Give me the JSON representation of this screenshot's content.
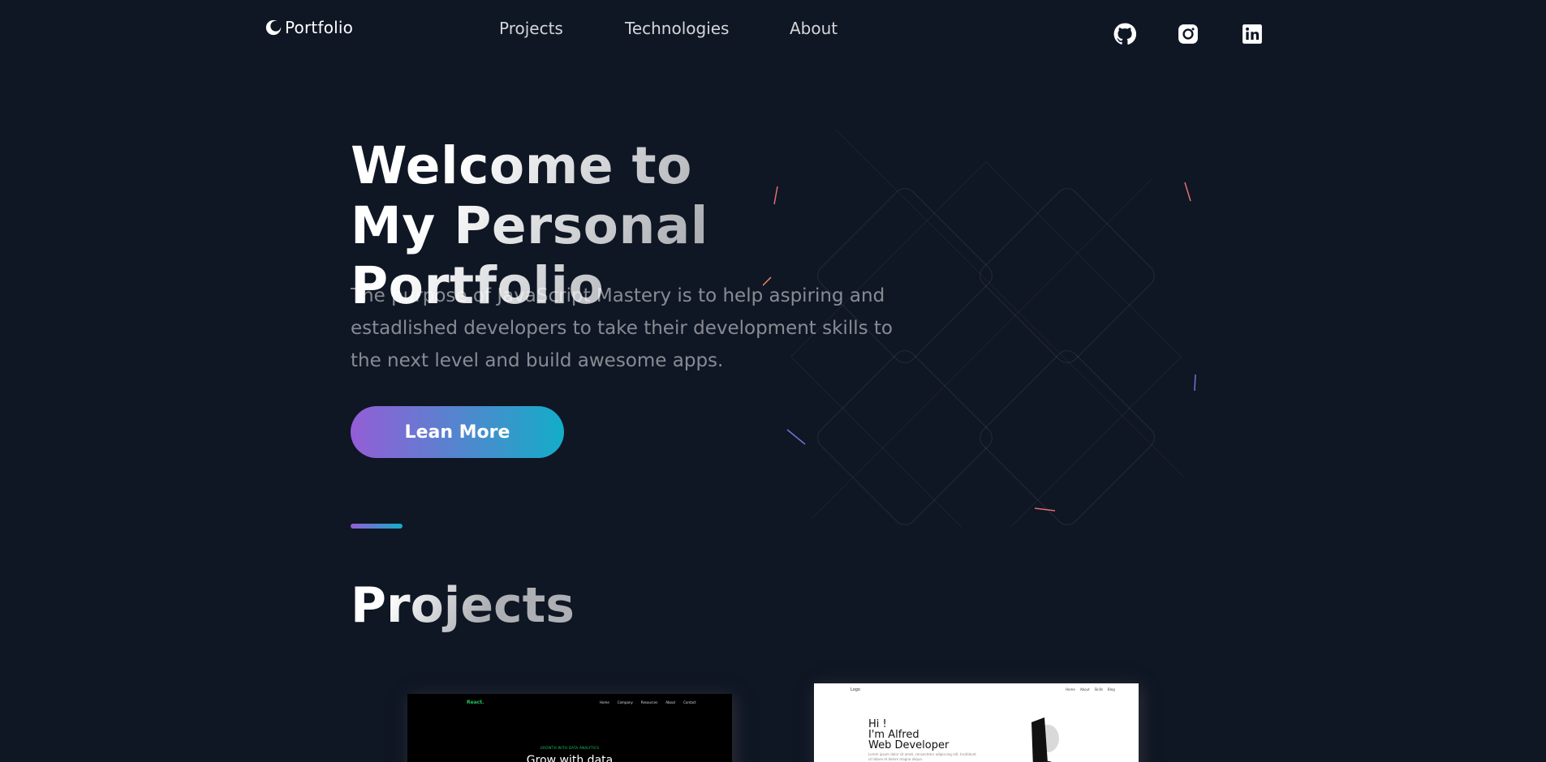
{
  "header": {
    "logo_text": "Portfolio",
    "nav": [
      "Projects",
      "Technologies",
      "About"
    ],
    "social": [
      "github-icon",
      "instagram-icon",
      "linkedin-icon"
    ]
  },
  "hero": {
    "title_line1": "Welcome to",
    "title_line2": "My Personal Portfolio",
    "text": "The purpose of JavaScript Mastery is to help aspiring and estadlished developers to take their development skills to the next level and build awesome apps.",
    "button_label": "Lean More"
  },
  "projects": {
    "title": "Projects",
    "card1": {
      "brand": "React.",
      "nav": [
        "Home",
        "Company",
        "Resources",
        "About",
        "Contact"
      ],
      "kicker": "GROWTH WITH DATA ANALYTICS",
      "headline": "Grow with data"
    },
    "card2": {
      "logo": "Logo",
      "nav": [
        "Home",
        "About",
        "Skills",
        "Blog"
      ],
      "hi": "Hi !",
      "name_line": "I'm Alfred",
      "role": "Web Developer",
      "sub": "Lorem ipsum dolor sit amet, consectetur adipiscing elit. Incididunt ut labore et dolore magna aliqua."
    }
  },
  "colors": {
    "background": "#0f1624",
    "gradient_start": "#945dd6",
    "gradient_end": "#13adc7"
  }
}
